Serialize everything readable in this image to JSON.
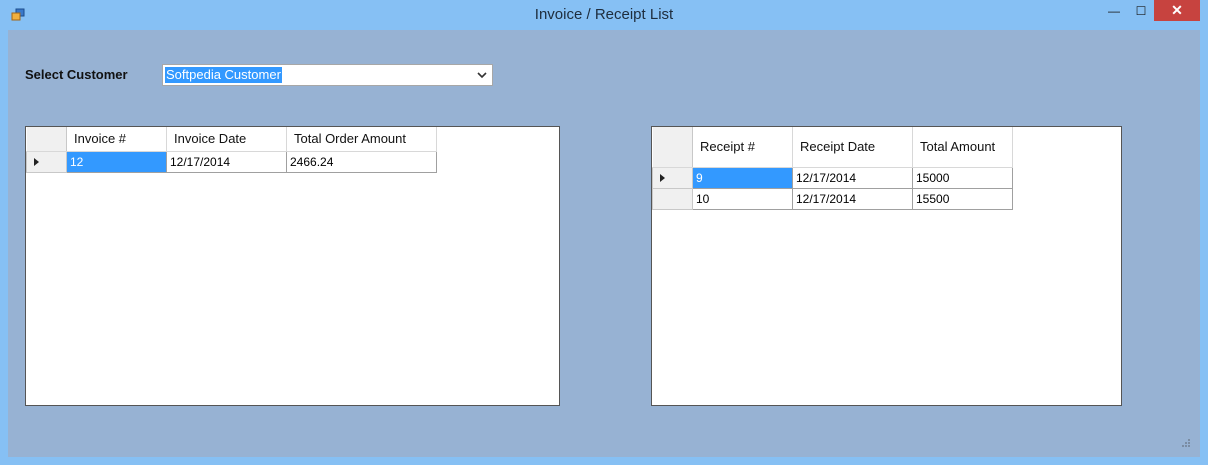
{
  "window": {
    "title": "Invoice / Receipt List",
    "minimize_glyph": "—",
    "maximize_glyph": "☐",
    "close_glyph": "✕"
  },
  "customer": {
    "label": "Select Customer",
    "selected": "Softpedia Customer"
  },
  "invoices": {
    "columns": [
      "Invoice #",
      "Invoice Date",
      "Total Order Amount"
    ],
    "rows": [
      [
        "12",
        "12/17/2014",
        "2466.24"
      ]
    ]
  },
  "receipts": {
    "columns": [
      "Receipt #",
      "Receipt Date",
      "Total Amount"
    ],
    "rows": [
      [
        "9",
        "12/17/2014",
        "15000"
      ],
      [
        "10",
        "12/17/2014",
        "15500"
      ]
    ]
  },
  "colors": {
    "selection": "#3399ff",
    "client_background": "#97b2d3",
    "frame": "#86c0f4",
    "close_button": "#c7433f"
  },
  "icons": {
    "app": "app-window-icon",
    "combo_arrow": "chevron-down-icon",
    "row_indicator": "row-pointer-icon",
    "grip": "resize-grip-icon"
  }
}
